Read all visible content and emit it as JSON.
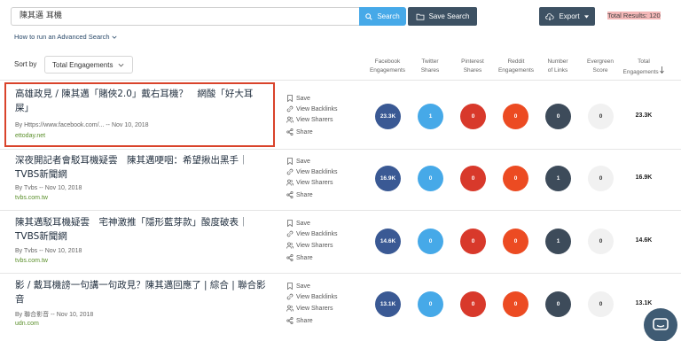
{
  "search": {
    "query": "陳其邁 耳機",
    "search_label": "Search",
    "save_search_label": "Save Search",
    "export_label": "Export",
    "total_results": "Total Results: 120"
  },
  "advanced_link": "How to run an Advanced Search",
  "sort": {
    "label": "Sort by",
    "value": "Total Engagements"
  },
  "columns": {
    "facebook": [
      "Facebook",
      "Engagements"
    ],
    "twitter": [
      "Twitter",
      "Shares"
    ],
    "pinterest": [
      "Pinterest",
      "Shares"
    ],
    "reddit": [
      "Reddit",
      "Engagements"
    ],
    "links": [
      "Number",
      "of Links"
    ],
    "evergreen": [
      "Evergreen",
      "Score"
    ],
    "total": [
      "Total",
      "Engagements"
    ]
  },
  "actions": {
    "save": "Save",
    "backlinks": "View Backlinks",
    "sharers": "View Sharers",
    "share": "Share"
  },
  "articles": [
    {
      "title": "高雄政見 / 陳其邁「賭俠2.0」戴右耳機？　網酸「好大耳屎」",
      "byline": "By Https://www.facebook.com/...",
      "date": "Nov 10, 2018",
      "domain": "ettoday.net",
      "facebook": "23.3K",
      "twitter": "1",
      "pinterest": "0",
      "reddit": "0",
      "links": "0",
      "evergreen": "0",
      "total": "23.3K"
    },
    {
      "title": "深夜開記者會駁耳機疑雲　陳其邁哽咽：希望揪出黑手｜TVBS新聞網",
      "byline": "By Tvbs",
      "date": "Nov 10, 2018",
      "domain": "tvbs.com.tw",
      "facebook": "16.9K",
      "twitter": "0",
      "pinterest": "0",
      "reddit": "0",
      "links": "1",
      "evergreen": "0",
      "total": "16.9K"
    },
    {
      "title": "陳其邁駁耳機疑雲　宅神激推「隱形藍芽款」酸度破表｜TVBS新聞網",
      "byline": "By Tvbs",
      "date": "Nov 10, 2018",
      "domain": "tvbs.com.tw",
      "facebook": "14.6K",
      "twitter": "0",
      "pinterest": "0",
      "reddit": "0",
      "links": "1",
      "evergreen": "0",
      "total": "14.6K"
    },
    {
      "title": "影 / 戴耳機謗一句講一句政見？陳其邁回應了 | 綜合 | 聯合影音",
      "byline": "By 聯合影音",
      "date": "Nov 10, 2018",
      "domain": "udn.com",
      "facebook": "13.1K",
      "twitter": "0",
      "pinterest": "0",
      "reddit": "0",
      "links": "0",
      "evergreen": "0",
      "total": "13.1K"
    }
  ]
}
